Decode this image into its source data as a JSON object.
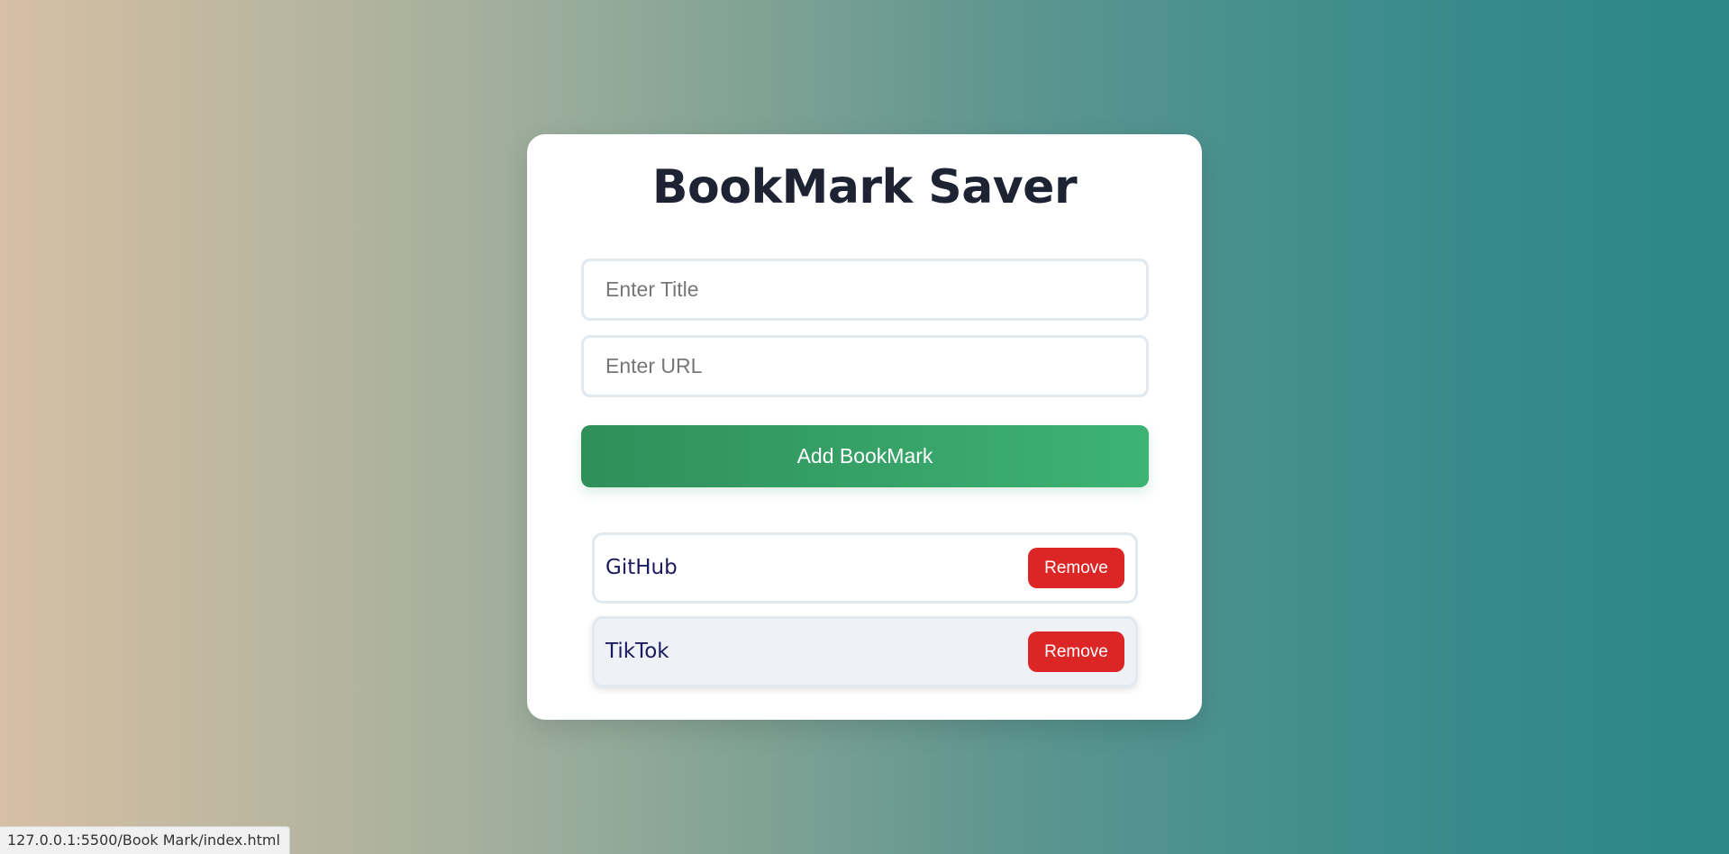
{
  "app": {
    "title": "BookMark Saver"
  },
  "form": {
    "title_value": "",
    "title_placeholder": "Enter Title",
    "url_value": "",
    "url_placeholder": "Enter URL",
    "add_label": "Add BookMark"
  },
  "bookmarks": [
    {
      "title": "GitHub",
      "remove_label": "Remove"
    },
    {
      "title": "TikTok",
      "remove_label": "Remove"
    }
  ],
  "status_bar": {
    "url": "127.0.0.1:5500/Book Mark/index.html"
  },
  "colors": {
    "primary_green": "#38a169",
    "danger_red": "#dc2626",
    "heading": "#1e2333",
    "link": "#1a1a5e"
  }
}
